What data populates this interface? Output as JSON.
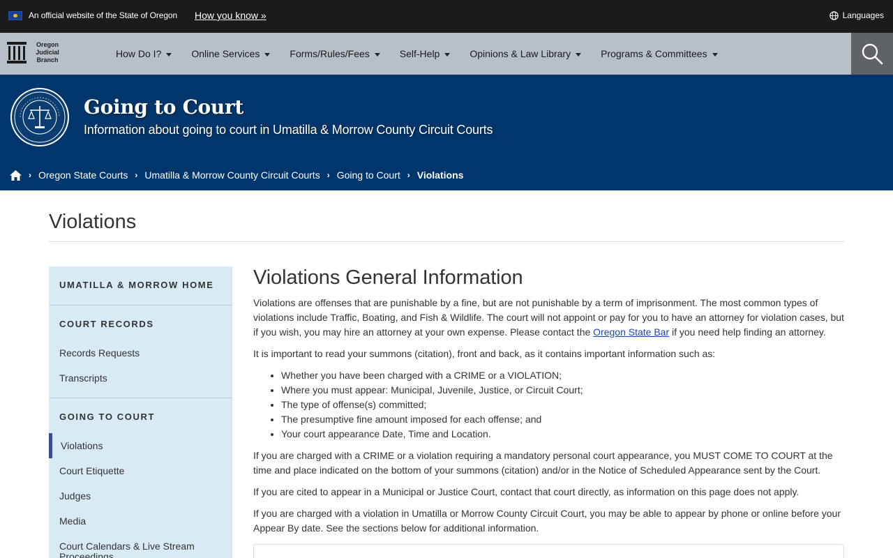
{
  "gov_banner": {
    "text": "An official website of the State of Oregon",
    "link": "How you know »",
    "languages": "Languages"
  },
  "brand": {
    "line1": "Oregon",
    "line2": "Judicial",
    "line3": "Branch"
  },
  "nav": {
    "items": [
      {
        "label": "How Do I?"
      },
      {
        "label": "Online Services"
      },
      {
        "label": "Forms/Rules/Fees"
      },
      {
        "label": "Self-Help"
      },
      {
        "label": "Opinions & Law Library"
      },
      {
        "label": "Programs & Committees"
      }
    ]
  },
  "hero": {
    "title": "Going to Court",
    "subtitle": "Information about going to court in Umatilla & Morrow County Circuit Courts"
  },
  "breadcrumb": {
    "items": [
      {
        "label": "Oregon State Courts"
      },
      {
        "label": "Umatilla & Morrow County Circuit Courts"
      },
      {
        "label": "Going to Court"
      },
      {
        "label": "Violations"
      }
    ]
  },
  "page": {
    "title": "Violations"
  },
  "sidebar": {
    "home": "UMATILLA & MORROW HOME",
    "records_head": "COURT RECORDS",
    "records_links": [
      "Records Requests",
      "Transcripts"
    ],
    "court_head": "GOING TO COURT",
    "court_links": [
      "Violations",
      "Court Etiquette",
      "Judges",
      "Media",
      "Court Calendars & Live Stream",
      "Proceedings"
    ]
  },
  "content": {
    "heading": "Violations General Information",
    "p1_a": "Violations are offenses that are punishable by a fine, but are not punishable by a term of imprisonment. The most common types of violations include Traffic, Boating, and Fish & Wildlife. The court will not appoint or pay for you to have an attorney for violation cases, but if you wish, you may hire an attorney at your own expense. Please contact the ",
    "p1_link": "Oregon State Bar",
    "p1_b": " if you need help finding an attorney.",
    "p2": "It is important to read your summons (citation), front and back, as it contains important information such as:",
    "bullets": [
      "Whether you have been charged with a CRIME or a VIOLATION;",
      "Where you must appear: Municipal, Juvenile, Justice, or Circuit Court;",
      "The type of offense(s) committed;",
      "The presumptive fine amount imposed for each offense; and",
      "Your court appearance Date, Time and Location."
    ],
    "p3": "If you are charged with a CRIME or a violation requiring a mandatory personal court appearance, you MUST COME TO COURT at the time and place indicated on the bottom of your summons (citation) and/or in the Notice of Scheduled Appearance sent by the Court.",
    "p4": "If you are cited to appear in a Municipal or Justice Court, contact that court directly, as information on this page does not apply.",
    "p5": "If you are charged with a violation in Umatilla or Morrow County Circuit Court, you may be able to appear by phone or online before your Appear By date. See the sections below for additional information."
  },
  "colors": {
    "gov_bar": "#1b1b1b",
    "nav_bar": "#b7bfc8",
    "hero": "#00366b",
    "sidebar": "#d9eaf7",
    "link": "#1a47a8"
  }
}
